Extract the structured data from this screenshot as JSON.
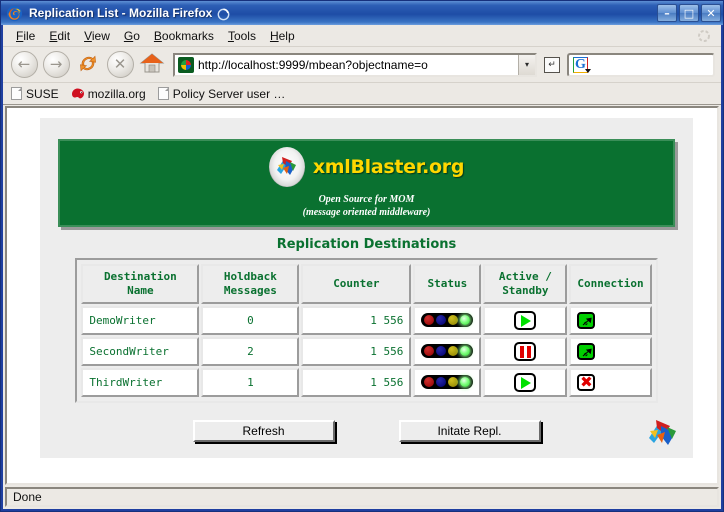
{
  "window": {
    "title": "Replication List - Mozilla Firefox",
    "minimize_label": "–",
    "maximize_label": "□",
    "close_label": "✕"
  },
  "menubar": {
    "items": [
      {
        "pre": "",
        "accel": "F",
        "post": "ile"
      },
      {
        "pre": "",
        "accel": "E",
        "post": "dit"
      },
      {
        "pre": "",
        "accel": "V",
        "post": "iew"
      },
      {
        "pre": "",
        "accel": "G",
        "post": "o"
      },
      {
        "pre": "",
        "accel": "B",
        "post": "ookmarks"
      },
      {
        "pre": "",
        "accel": "T",
        "post": "ools"
      },
      {
        "pre": "",
        "accel": "H",
        "post": "elp"
      }
    ]
  },
  "toolbar": {
    "back_glyph": "←",
    "forward_glyph": "→",
    "reload_glyph": "↻",
    "stop_glyph": "✕",
    "home_glyph": "⌂",
    "url_value": "http://localhost:9999/mbean?objectname=o",
    "url_dropdown_glyph": "▾",
    "go_glyph": "↵",
    "search_value": "",
    "search_placeholder": "",
    "search_engine_letter": "G"
  },
  "bookmarks": {
    "items": [
      {
        "label": "SUSE",
        "icon": "document-icon"
      },
      {
        "label": "mozilla.org",
        "icon": "mozilla-icon"
      },
      {
        "label": "Policy Server user …",
        "icon": "document-icon"
      }
    ]
  },
  "page": {
    "banner": {
      "brand": "xmlBlaster.org",
      "tagline_line1": "Open Source for MOM",
      "tagline_line2": "(message oriented middleware)"
    },
    "section_title": "Replication Destinations",
    "table": {
      "headers": [
        "Destination\nName",
        "Holdback\nMessages",
        "Counter",
        "Status",
        "Active /\nStandby",
        "Connection"
      ],
      "rows": [
        {
          "name": "DemoWriter",
          "holdback": "0",
          "counter": "1 556",
          "status_lamps": [
            "red",
            "blue",
            "yellow",
            "green-on"
          ],
          "active": "play",
          "connection": "connected"
        },
        {
          "name": "SecondWriter",
          "holdback": "2",
          "counter": "1 556",
          "status_lamps": [
            "red",
            "blue",
            "yellow",
            "green-on"
          ],
          "active": "pause",
          "connection": "connected"
        },
        {
          "name": "ThirdWriter",
          "holdback": "1",
          "counter": "1 556",
          "status_lamps": [
            "red",
            "blue",
            "yellow",
            "green-on"
          ],
          "active": "play",
          "connection": "disconnected"
        }
      ]
    },
    "buttons": {
      "refresh": "Refresh",
      "initiate": "Initate Repl."
    }
  },
  "statusbar": {
    "text": "Done"
  },
  "colors": {
    "brand_green": "#0a7130",
    "brand_yellow": "#ffd700",
    "titlebar_blue": "#1f3fa0",
    "lamp_on_green": "#30d030",
    "action_red": "#e00000"
  }
}
